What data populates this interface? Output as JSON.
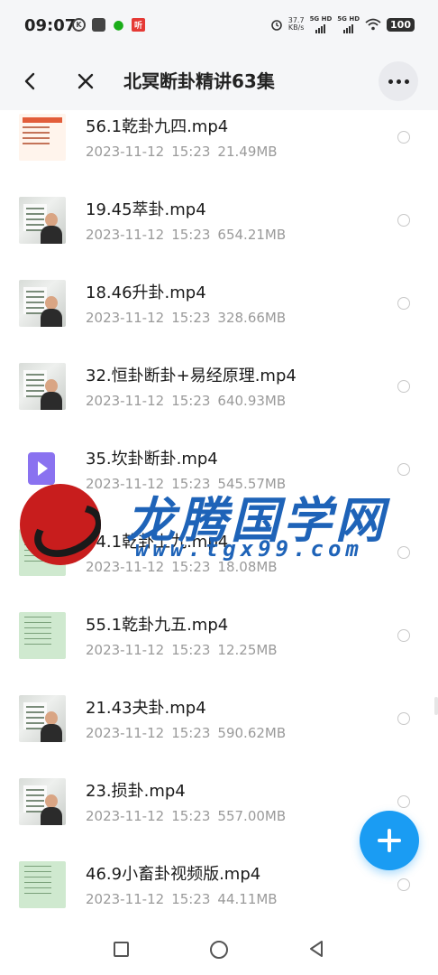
{
  "status_bar": {
    "time": "09:07",
    "net_speed_value": "37.7",
    "net_speed_unit": "KB/s",
    "sim1": "5G HD",
    "sim2": "5G HD",
    "battery": "100"
  },
  "header": {
    "title": "北冥断卦精讲63集"
  },
  "files": [
    {
      "name": "56.1乾卦九四.mp4",
      "date": "2023-11-12",
      "time": "15:23",
      "size": "21.49MB",
      "thumb": "doc"
    },
    {
      "name": "19.45萃卦.mp4",
      "date": "2023-11-12",
      "time": "15:23",
      "size": "654.21MB",
      "thumb": "video"
    },
    {
      "name": "18.46升卦.mp4",
      "date": "2023-11-12",
      "time": "15:23",
      "size": "328.66MB",
      "thumb": "video"
    },
    {
      "name": "32.恒卦断卦+易经原理.mp4",
      "date": "2023-11-12",
      "time": "15:23",
      "size": "640.93MB",
      "thumb": "video"
    },
    {
      "name": "35.坎卦断卦.mp4",
      "date": "2023-11-12",
      "time": "15:23",
      "size": "545.57MB",
      "thumb": "play"
    },
    {
      "name": "54.1乾卦上九.mp4",
      "date": "2023-11-12",
      "time": "15:23",
      "size": "18.08MB",
      "thumb": "green"
    },
    {
      "name": "55.1乾卦九五.mp4",
      "date": "2023-11-12",
      "time": "15:23",
      "size": "12.25MB",
      "thumb": "green"
    },
    {
      "name": "21.43夬卦.mp4",
      "date": "2023-11-12",
      "time": "15:23",
      "size": "590.62MB",
      "thumb": "video"
    },
    {
      "name": "23.损卦.mp4",
      "date": "2023-11-12",
      "time": "15:23",
      "size": "557.00MB",
      "thumb": "video"
    },
    {
      "name": "46.9小畜卦视频版.mp4",
      "date": "2023-11-12",
      "time": "15:23",
      "size": "44.11MB",
      "thumb": "green"
    }
  ],
  "watermark": {
    "text": "龙腾国学网",
    "url": "www.tgx99.com"
  },
  "colors": {
    "accent": "#1a9cf3",
    "watermark": "#1e63b8",
    "meta_text": "#9a9a9a"
  }
}
